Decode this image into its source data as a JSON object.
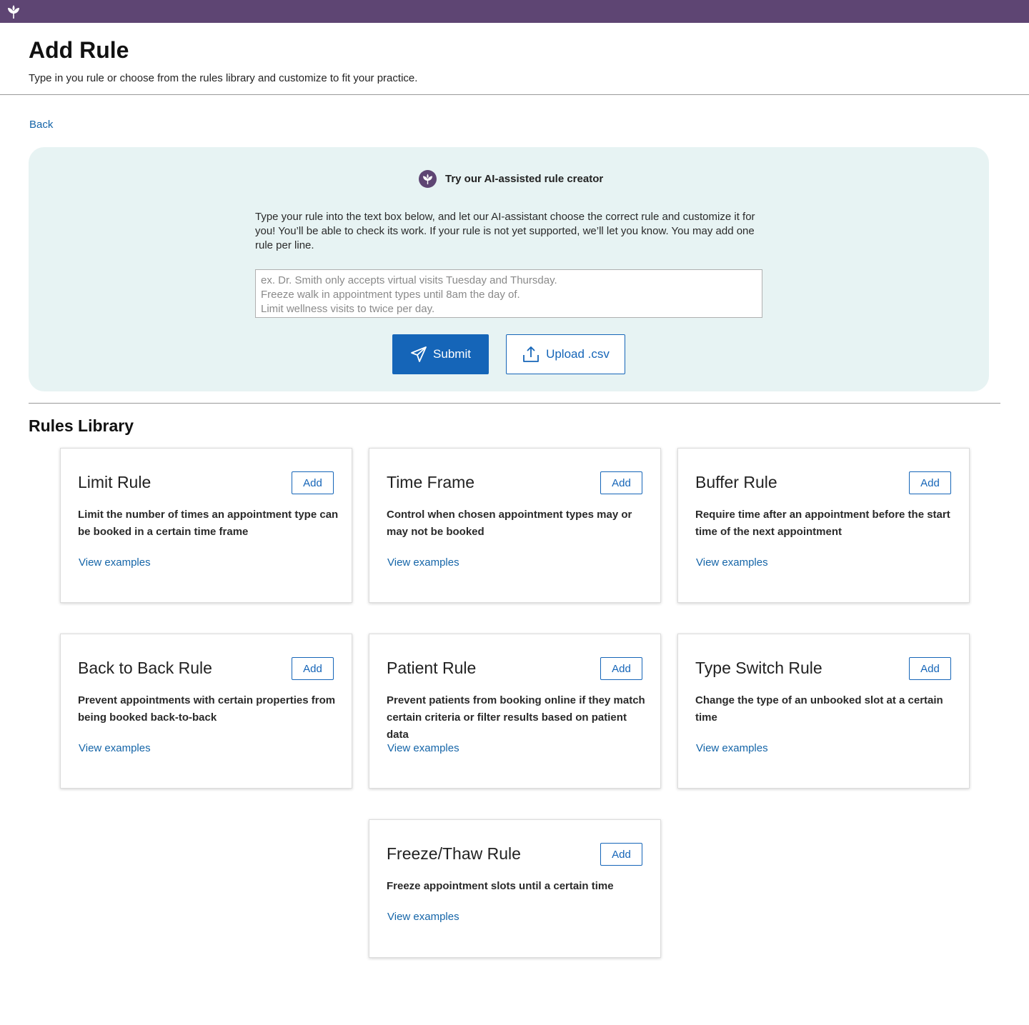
{
  "page": {
    "title": "Add Rule",
    "subtitle": "Type in you rule or choose from the rules library and customize to fit your practice.",
    "back_label": "Back"
  },
  "brand": {
    "topbar_color": "#5e4573",
    "primary_color": "#1565b8",
    "logo_icon": "leaf-logo-icon"
  },
  "ai_creator": {
    "title": "Try our AI-assisted rule creator",
    "description": "Type your rule into the text box below, and let our AI-assistant choose the correct rule and customize it for you! You’ll be able to check its work. If your rule is not yet supported, we’ll let you know. You may add one rule per line.",
    "placeholder": "ex. Dr. Smith only accepts virtual visits Tuesday and Thursday.\nFreeze walk in appointment types until 8am the day of.\nLimit wellness visits to twice per day.",
    "value": "",
    "submit_label": "Submit",
    "upload_label": "Upload .csv"
  },
  "library": {
    "title": "Rules Library",
    "add_label": "Add",
    "view_examples_label": "View examples",
    "rules": [
      {
        "title": "Limit Rule",
        "description": "Limit the number of times an appointment type can be booked in a certain time frame"
      },
      {
        "title": "Time Frame",
        "description": "Control when chosen appointment types may or may not be booked"
      },
      {
        "title": "Buffer Rule",
        "description": "Require time after an appointment before the start time of the next appointment"
      },
      {
        "title": "Back to Back Rule",
        "description": "Prevent appointments with certain properties from being booked back-to-back"
      },
      {
        "title": "Patient Rule",
        "description": "Prevent patients from booking online if they match certain criteria or filter results based on patient data"
      },
      {
        "title": "Type Switch Rule",
        "description": "Change the type of an unbooked slot at a certain time"
      },
      {
        "title": "Freeze/Thaw Rule",
        "description": "Freeze appointment slots until a certain time"
      }
    ]
  }
}
